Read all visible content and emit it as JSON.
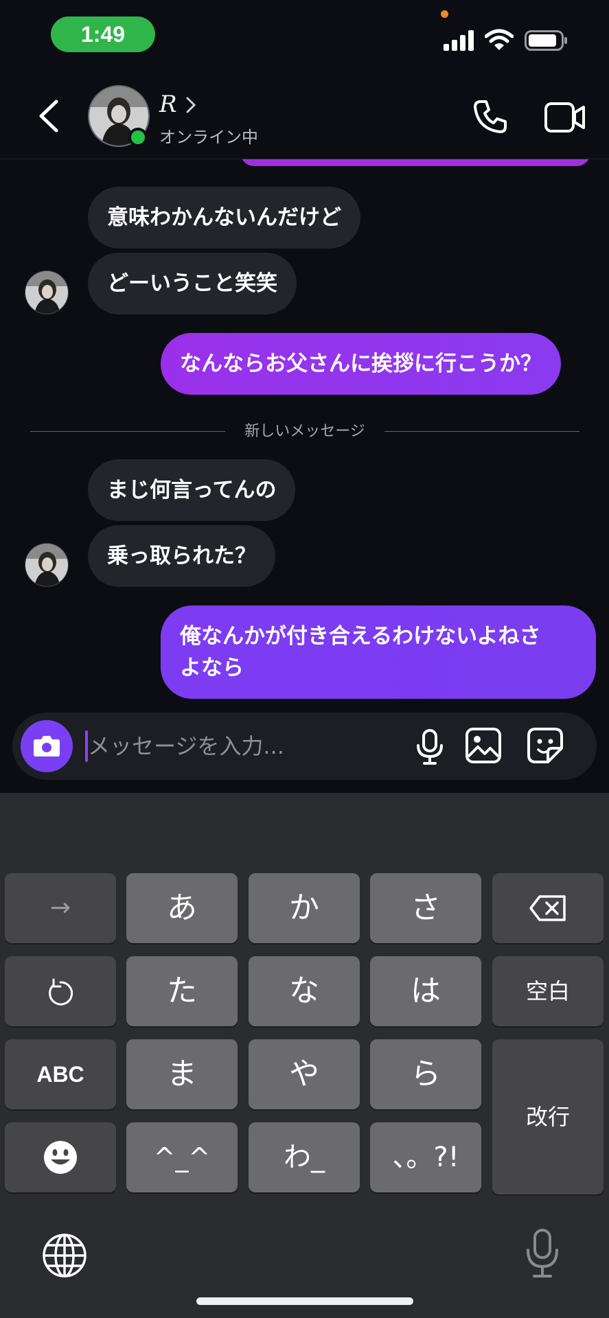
{
  "status_bar": {
    "time": "1:49",
    "icons": [
      "signal-icon",
      "wifi-icon",
      "battery-icon"
    ],
    "time_pill_color": "#2fb54a"
  },
  "header": {
    "contact_name": "R",
    "status": "オンライン中",
    "online_color": "#22c244",
    "icons": [
      "back-icon",
      "chevron-right-icon",
      "phone-icon",
      "video-icon"
    ]
  },
  "messages": {
    "incoming_group_1": [
      "意味わかんないんだけど",
      "どーいうこと笑笑"
    ],
    "outgoing_1": "なんならお父さんに挨拶に行こうか？",
    "divider_label": "新しいメッセージ",
    "incoming_group_2": [
      "まじ何言ってんの",
      "乗っ取られた？"
    ],
    "outgoing_2_lines": [
      "俺なんかが付き合えるわけないよねさ",
      "よなら"
    ],
    "outgoing_color": "#8a3af0"
  },
  "composer": {
    "placeholder": "メッセージを入力...",
    "icons": [
      "camera-icon",
      "microphone-icon",
      "image-icon",
      "sticker-icon"
    ],
    "accent": "#7a3ff2"
  },
  "keyboard": {
    "row1": [
      "→",
      "あ",
      "か",
      "さ",
      "backspace"
    ],
    "row2": [
      "undo",
      "た",
      "な",
      "は",
      "空白"
    ],
    "row3": [
      "ABC",
      "ま",
      "や",
      "ら",
      "改行"
    ],
    "row4": [
      "emoji",
      "^_^",
      "わ_",
      "、。?!"
    ],
    "bottom_icons": [
      "globe-icon",
      "dictation-icon"
    ]
  }
}
